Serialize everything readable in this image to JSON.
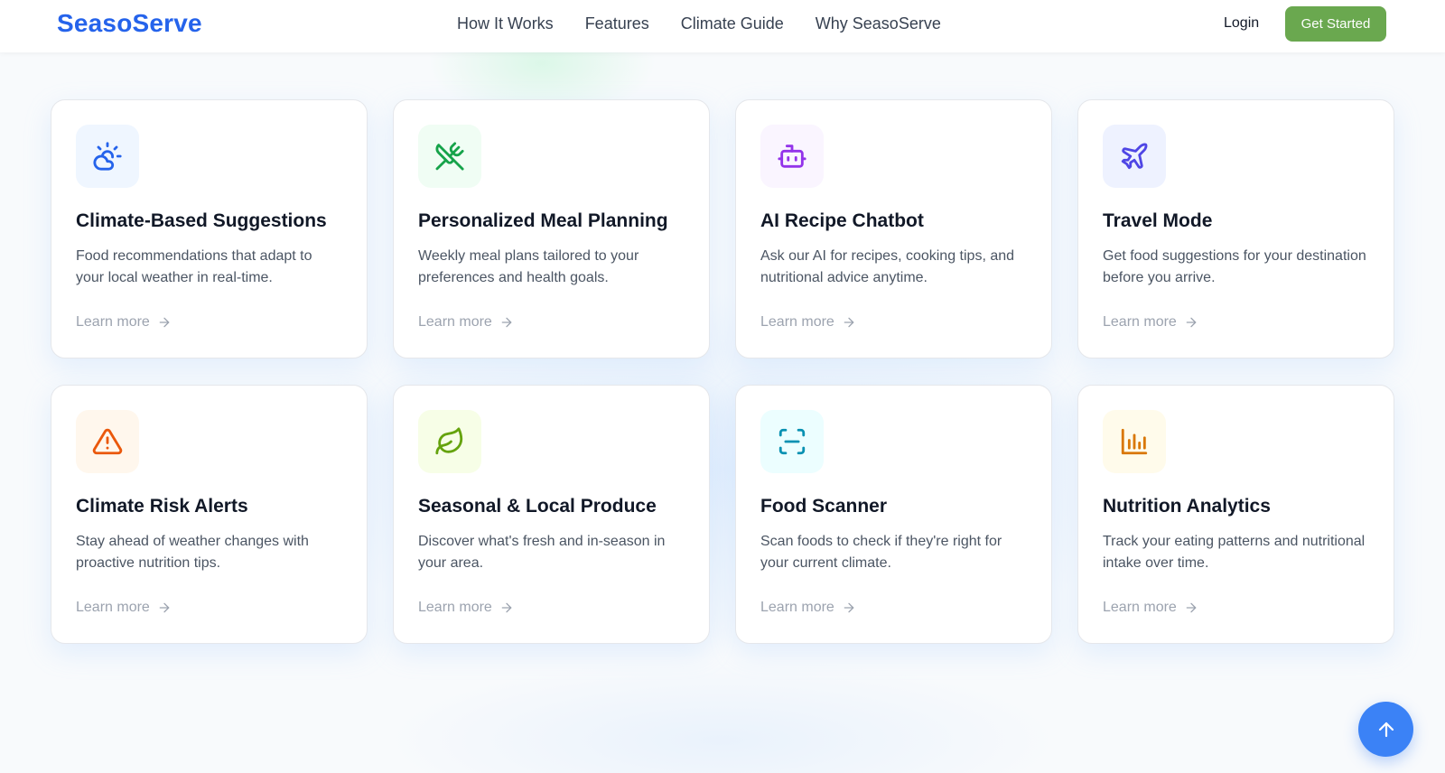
{
  "brand": {
    "name": "SeasoServe",
    "color": "#2563eb"
  },
  "nav": {
    "links": [
      "How It Works",
      "Features",
      "Climate Guide",
      "Why SeasoServe"
    ],
    "login": "Login",
    "cta": "Get Started"
  },
  "features": [
    {
      "title": "Climate-Based Suggestions",
      "description": "Food recommendations that adapt to your local weather in real-time.",
      "link": "Learn more",
      "icon": "weather-sun-cloud-icon",
      "icon_color": "#2563eb",
      "icon_bg": "#eff6ff"
    },
    {
      "title": "Personalized Meal Planning",
      "description": "Weekly meal plans tailored to your preferences and health goals.",
      "link": "Learn more",
      "icon": "utensils-crossed-icon",
      "icon_color": "#16a34a",
      "icon_bg": "#f0fdf4"
    },
    {
      "title": "AI Recipe Chatbot",
      "description": "Ask our AI for recipes, cooking tips, and nutritional advice anytime.",
      "link": "Learn more",
      "icon": "robot-icon",
      "icon_color": "#9333ea",
      "icon_bg": "#faf5ff"
    },
    {
      "title": "Travel Mode",
      "description": "Get food suggestions for your destination before you arrive.",
      "link": "Learn more",
      "icon": "plane-icon",
      "icon_color": "#4f46e5",
      "icon_bg": "#eef2ff"
    },
    {
      "title": "Climate Risk Alerts",
      "description": "Stay ahead of weather changes with proactive nutrition tips.",
      "link": "Learn more",
      "icon": "warning-triangle-icon",
      "icon_color": "#ea580c",
      "icon_bg": "#fff7ed"
    },
    {
      "title": "Seasonal & Local Produce",
      "description": "Discover what's fresh and in-season in your area.",
      "link": "Learn more",
      "icon": "leaf-icon",
      "icon_color": "#65a30d",
      "icon_bg": "#f7fee7"
    },
    {
      "title": "Food Scanner",
      "description": "Scan foods to check if they're right for your current climate.",
      "link": "Learn more",
      "icon": "scan-icon",
      "icon_color": "#0891b2",
      "icon_bg": "#ecfeff"
    },
    {
      "title": "Nutrition Analytics",
      "description": "Track your eating patterns and nutritional intake over time.",
      "link": "Learn more",
      "icon": "bar-chart-icon",
      "icon_color": "#d97706",
      "icon_bg": "#fffbeb"
    }
  ],
  "scroll_top": {
    "icon": "arrow-up-icon",
    "color": "#3b82f6"
  }
}
